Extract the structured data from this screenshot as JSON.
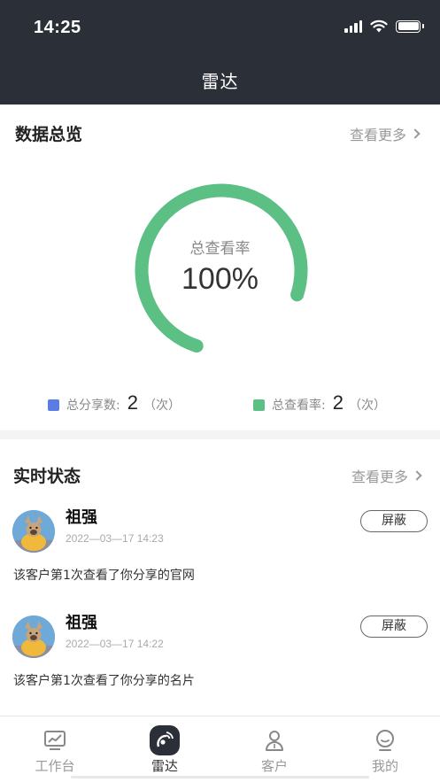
{
  "status_bar": {
    "time": "14:25"
  },
  "nav": {
    "title": "雷达"
  },
  "overview": {
    "title": "数据总览",
    "more_label": "查看更多",
    "gauge": {
      "label": "总查看率",
      "value_text": "100%",
      "fraction": 0.75,
      "color": "#5cbf84"
    },
    "stats": [
      {
        "label": "总分享数:",
        "value": "2",
        "unit": "（次）",
        "color": "#5b7be5"
      },
      {
        "label": "总查看率:",
        "value": "2",
        "unit": "（次）",
        "color": "#5cbf84"
      }
    ]
  },
  "realtime": {
    "title": "实时状态",
    "more_label": "查看更多",
    "items": [
      {
        "name": "祖强",
        "time": "2022—03—17 14:23",
        "action_label": "屏蔽",
        "description": "该客户第1次查看了你分享的官网"
      },
      {
        "name": "祖强",
        "time": "2022—03—17 14:22",
        "action_label": "屏蔽",
        "description": "该客户第1次查看了你分享的名片"
      }
    ]
  },
  "tabbar": {
    "tabs": [
      {
        "label": "工作台",
        "icon": "chart-monitor-icon",
        "active": false
      },
      {
        "label": "雷达",
        "icon": "radar-icon",
        "active": true
      },
      {
        "label": "客户",
        "icon": "customer-icon",
        "active": false
      },
      {
        "label": "我的",
        "icon": "profile-icon",
        "active": false
      }
    ]
  }
}
